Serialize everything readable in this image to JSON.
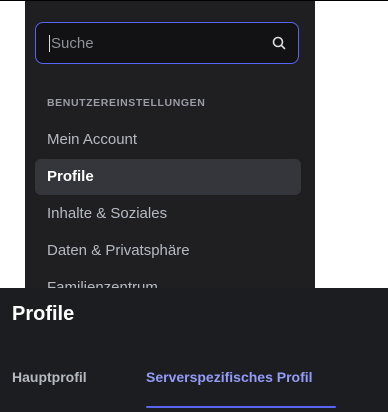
{
  "search": {
    "placeholder": "Suche"
  },
  "sidebar": {
    "section_header": "BENUTZEREINSTELLUNGEN",
    "items": [
      {
        "label": "Mein Account",
        "active": false
      },
      {
        "label": "Profile",
        "active": true
      },
      {
        "label": "Inhalte & Soziales",
        "active": false
      },
      {
        "label": "Daten & Privatsphäre",
        "active": false
      },
      {
        "label": "Familienzentrum",
        "active": false
      }
    ]
  },
  "main": {
    "title": "Profile",
    "tabs": [
      {
        "label": "Hauptprofil",
        "selected": false
      },
      {
        "label": "Serverspezifisches Profil",
        "selected": true
      }
    ]
  },
  "colors": {
    "accent": "#5865f2",
    "tab_selected": "#949cf7",
    "sidebar_bg": "#1f1f22",
    "main_bg": "#1c1d21"
  },
  "icons": {
    "search": "magnifier"
  }
}
